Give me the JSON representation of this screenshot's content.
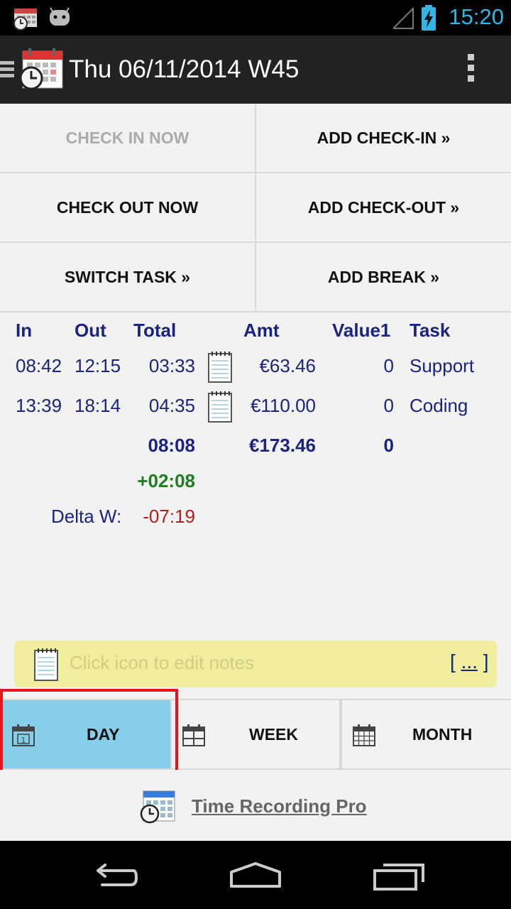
{
  "status_bar": {
    "time": "15:20",
    "icons": [
      "calendar-clock-notification-icon",
      "android-debug-icon",
      "signal-icon",
      "battery-charging-icon"
    ]
  },
  "action_bar": {
    "title": "Thu 06/11/2014 W45",
    "icons": [
      "drawer-indicator-icon",
      "app-calendar-clock-icon",
      "overflow-menu-icon"
    ]
  },
  "buttons": {
    "check_in_now": "CHECK IN NOW",
    "add_check_in": "ADD CHECK-IN »",
    "check_out_now": "CHECK OUT NOW",
    "add_check_out": "ADD CHECK-OUT »",
    "switch_task": "SWITCH TASK »",
    "add_break": "ADD BREAK »"
  },
  "table": {
    "headers": {
      "in": "In",
      "out": "Out",
      "total": "Total",
      "amt": "Amt",
      "value1": "Value1",
      "task": "Task"
    },
    "rows": [
      {
        "in": "08:42",
        "out": "12:15",
        "total": "03:33",
        "amt": "€63.46",
        "value1": "0",
        "task": "Support"
      },
      {
        "in": "13:39",
        "out": "18:14",
        "total": "04:35",
        "amt": "€110.00",
        "value1": "0",
        "task": "Coding"
      }
    ],
    "summary": {
      "total": "08:08",
      "amt": "€173.46",
      "value1": "0"
    },
    "overtime": "+02:08",
    "delta_label": "Delta W:",
    "delta_value": "-07:19"
  },
  "notes": {
    "placeholder": "Click icon to edit notes",
    "more_open": "[",
    "more_link": "...",
    "more_close": "]"
  },
  "tabs": [
    {
      "label": "DAY",
      "active": true
    },
    {
      "label": "WEEK",
      "active": false
    },
    {
      "label": "MONTH",
      "active": false
    }
  ],
  "footer": {
    "link": "Time Recording Pro"
  },
  "colors": {
    "accent_blue": "#33b5e5",
    "table_text": "#1a237e",
    "overtime_green": "#1e7e1e",
    "delta_red": "#b71c1c",
    "active_tab": "#87ceeb",
    "highlight": "#e8141b",
    "notes_bg": "#f0ee9c"
  }
}
